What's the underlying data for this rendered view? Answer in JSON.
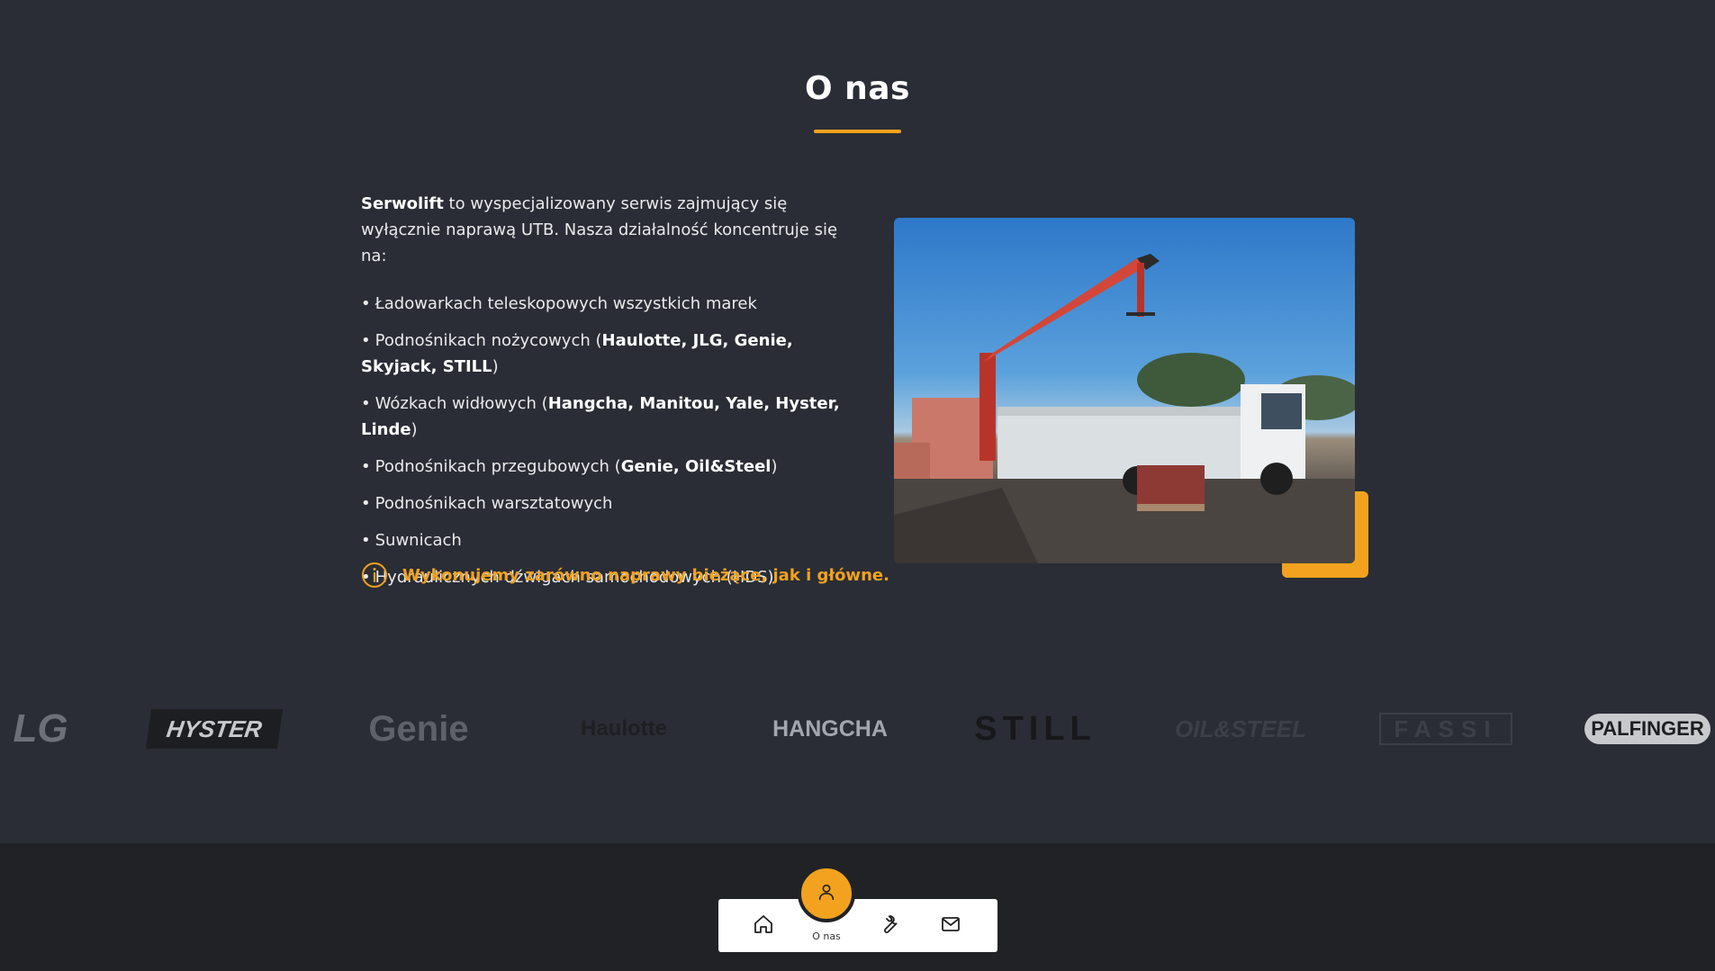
{
  "section": {
    "title": "O nas"
  },
  "about": {
    "intro_brand": "Serwolift",
    "intro_rest": " to wyspecjalizowany serwis zajmujący się wyłącznie naprawą UTB. Nasza działalność koncentruje się na:",
    "bullets": [
      {
        "text": "Ładowarkach teleskopowych wszystkich marek",
        "bold": "",
        "tail": ""
      },
      {
        "text": "Podnośnikach nożycowych (",
        "bold": "Haulotte, JLG, Genie, Skyjack, STILL",
        "tail": ")"
      },
      {
        "text": "Wózkach widłowych (",
        "bold": "Hangcha, Manitou, Yale, Hyster, Linde",
        "tail": ")"
      },
      {
        "text": "Podnośnikach przegubowych (",
        "bold": "Genie, Oil&Steel",
        "tail": ")"
      },
      {
        "text": "Podnośnikach warsztatowych",
        "bold": "",
        "tail": ""
      },
      {
        "text": "Suwnicach",
        "bold": "",
        "tail": ""
      },
      {
        "text": "Hydraulicznych dźwigach samochodowych (HDS)",
        "bold": "",
        "tail": ""
      }
    ],
    "bullet_char": "•",
    "notice": "Wykonujemy zarówno naprawy bieżące, jak i główne."
  },
  "photo": {
    "alt": "crane-truck-photo"
  },
  "logos": [
    "LG",
    "HYSTER",
    "Genie",
    "Haulotte",
    "HANGCHA",
    "STILL",
    "OIL&STEEL",
    "FASSI",
    "PALFINGER"
  ],
  "nav": {
    "active_label": "O nas",
    "items": [
      "home-icon",
      "user-icon",
      "wrench-icon",
      "mail-icon"
    ]
  },
  "colors": {
    "background": "#2a2d35",
    "footer": "#212226",
    "accent": "#f2a21e",
    "text": "#e9eaec"
  }
}
